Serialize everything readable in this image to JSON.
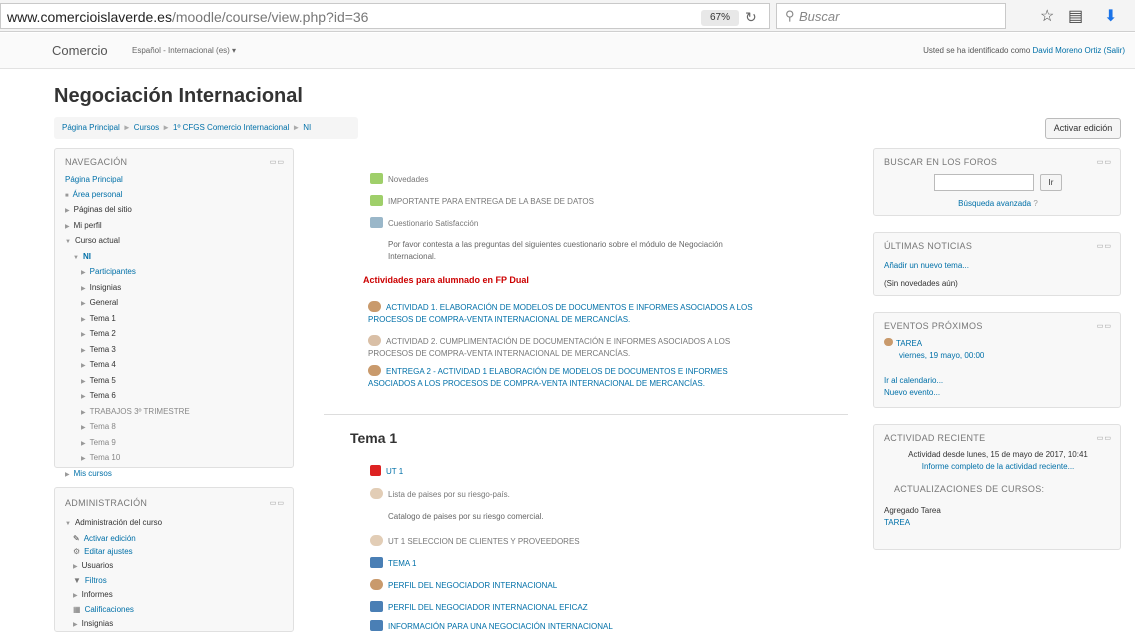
{
  "browser": {
    "url_host": "www.comercioislaverde.es",
    "url_path": "/moodle/course/view.php?id=36",
    "zoom": "67%",
    "search_placeholder": "Buscar"
  },
  "header": {
    "site_name": "Comercio",
    "language": "Español - Internacional (es) ▾",
    "login_prefix": "Usted se ha identificado como",
    "user_name": "David Moreno Ortiz",
    "logout": "(Salir)"
  },
  "page": {
    "course_title": "Negociación Internacional",
    "edit_button": "Activar edición",
    "breadcrumb": [
      "Página Principal",
      "Cursos",
      "1º CFGS Comercio Internacional",
      "NI"
    ]
  },
  "navigation": {
    "title": "NAVEGACIÓN",
    "home": "Página Principal",
    "personal": "Área personal",
    "site_pages": "Páginas del sitio",
    "my_profile": "Mi perfil",
    "current_course": "Curso actual",
    "course_short": "NI",
    "course_items": [
      "Participantes",
      "Insignias",
      "General",
      "Tema 1",
      "Tema 2",
      "Tema 3",
      "Tema 4",
      "Tema 5",
      "Tema 6",
      "TRABAJOS 3º TRIMESTRE",
      "Tema 8",
      "Tema 9",
      "Tema 10"
    ],
    "my_courses": "Mis cursos"
  },
  "administration": {
    "title": "ADMINISTRACIÓN",
    "course_admin": "Administración del curso",
    "items": [
      "Activar edición",
      "Editar ajustes",
      "Usuarios",
      "Filtros",
      "Informes",
      "Calificaciones",
      "Insignias"
    ]
  },
  "main": {
    "top_activities": [
      "Novedades",
      "IMPORTANTE PARA ENTREGA DE LA BASE DE DATOS",
      "Cuestionario Satisfacción"
    ],
    "quiz_description_1": "Por favor contesta a las preguntas del siguientes cuestionario sobre el módulo de Negociación",
    "quiz_description_2": "Internacional.",
    "dual_heading": "Actividades para alumnado en FP Dual",
    "dual_activities": [
      {
        "line1": "ACTIVIDAD 1. ELABORACIÓN DE MODELOS DE DOCUMENTOS E INFORMES ASOCIADOS A LOS",
        "line2": "PROCESOS DE COMPRA-VENTA INTERNACIONAL DE MERCANCÍAS."
      },
      {
        "line1": "ACTIVIDAD 2. CUMPLIMENTACIÓN DE DOCUMENTACIÓN E INFORMES ASOCIADOS A LOS",
        "line2": "PROCESOS DE COMPRA-VENTA INTERNACIONAL DE MERCANCÍAS."
      },
      {
        "line1": "ENTREGA 2 - ACTIVIDAD 1 ELABORACIÓN DE MODELOS DE DOCUMENTOS E INFORMES",
        "line2": "ASOCIADOS A LOS PROCESOS DE COMPRA-VENTA INTERNACIONAL DE MERCANCÍAS."
      }
    ],
    "section_title": "Tema 1",
    "tema1_items": [
      "UT 1",
      "Lista de paises por su riesgo-país.",
      "Catalogo de paises por su riesgo comercial.",
      "UT 1 SELECCION DE CLIENTES Y PROVEEDORES",
      "TEMA 1",
      "PERFIL DEL NEGOCIADOR INTERNACIONAL",
      "PERFIL DEL NEGOCIADOR INTERNACIONAL EFICAZ",
      "INFORMACIÓN PARA UNA NEGOCIACIÓN INTERNACIONAL"
    ]
  },
  "forum_search": {
    "title": "BUSCAR EN LOS FOROS",
    "go": "Ir",
    "advanced": "Búsqueda avanzada"
  },
  "news": {
    "title": "ÚLTIMAS NOTICIAS",
    "add": "Añadir un nuevo tema...",
    "empty": "(Sin novedades aún)"
  },
  "events": {
    "title": "EVENTOS PRÓXIMOS",
    "event_name": "TAREA",
    "event_date": "viernes, 19 mayo, 00:00",
    "calendar": "Ir al calendario...",
    "new_event": "Nuevo evento..."
  },
  "recent": {
    "title": "ACTIVIDAD RECIENTE",
    "since": "Actividad desde lunes, 15 de mayo de 2017, 10:41",
    "report": "Informe completo de la actividad reciente...",
    "updates_title": "ACTUALIZACIONES DE CURSOS:",
    "added": "Agregado Tarea",
    "task": "TAREA"
  }
}
